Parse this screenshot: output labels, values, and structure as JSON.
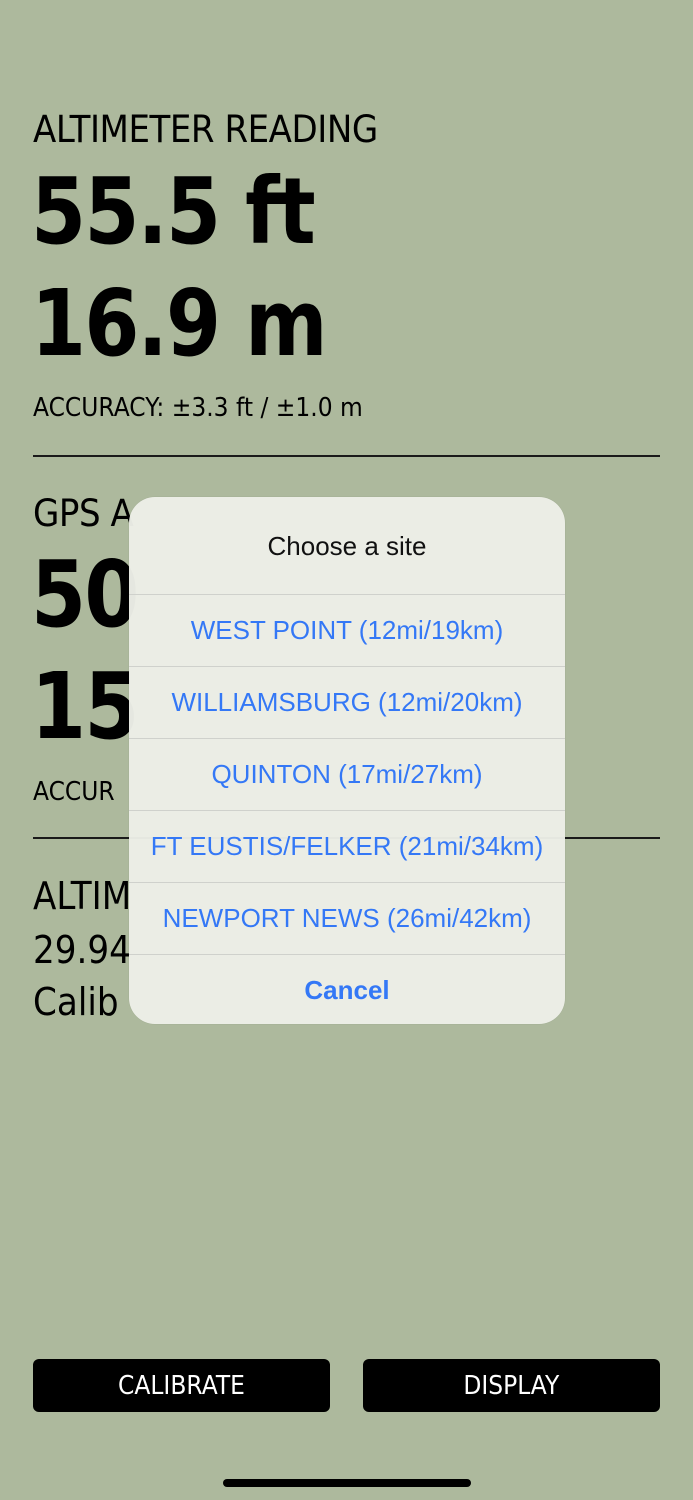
{
  "altimeter": {
    "heading": "ALTIMETER READING",
    "feet": "55.5 ft",
    "meters": "16.9 m",
    "accuracy": "ACCURACY: ±3.3 ft / ±1.0 m"
  },
  "gps": {
    "heading_partial": "GPS A",
    "feet_partial": "50",
    "meters_partial": "15",
    "accuracy_partial": "ACCUR"
  },
  "calibration": {
    "heading_partial": "ALTIM",
    "pressure_partial": "29.94",
    "status_partial": "Calib"
  },
  "dialog": {
    "title": "Choose a site",
    "options": [
      "WEST POINT (12mi/19km)",
      "WILLIAMSBURG (12mi/20km)",
      "QUINTON (17mi/27km)",
      "FT EUSTIS/FELKER (21mi/34km)",
      "NEWPORT NEWS (26mi/42km)"
    ],
    "cancel": "Cancel"
  },
  "buttons": {
    "calibrate": "CALIBRATE",
    "display": "DISPLAY"
  },
  "colors": {
    "background": "#adb99d",
    "link_blue": "#3478f6",
    "button_bg": "#000000"
  }
}
